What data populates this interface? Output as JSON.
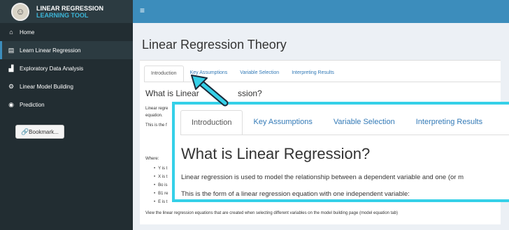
{
  "brand": {
    "title_line1": "LINEAR REGRESSION",
    "title_line2": "LEARNING TOOL",
    "logo_icon": "monk-avatar-icon"
  },
  "topbar": {
    "toggle_glyph": "≡",
    "color": "#3c8dbc"
  },
  "sidebar": {
    "items": [
      {
        "label": "Home",
        "icon": "home-icon",
        "glyph": "⌂"
      },
      {
        "label": "Learn Linear Regression",
        "icon": "book-icon",
        "glyph": "▤"
      },
      {
        "label": "Exploratory Data Analysis",
        "icon": "bar-chart-icon",
        "glyph": "▟"
      },
      {
        "label": "Linear Model Building",
        "icon": "gears-icon",
        "glyph": "⚙"
      },
      {
        "label": "Prediction",
        "icon": "dashboard-icon",
        "glyph": "◉"
      }
    ],
    "active_index": 1,
    "bookmark_label": "Bookmark...",
    "bookmark_glyph": "🔗"
  },
  "main": {
    "page_title": "Linear Regression Theory",
    "tabs": [
      "Introduction",
      "Key Assumptions",
      "Variable Selection",
      "Interpreting Results"
    ],
    "active_tab": "Introduction",
    "heading_partial_left": "What is Linear",
    "heading_partial_right": "ssion?",
    "intro_partial_1": "Linear regre",
    "intro_partial_2": "equation.",
    "intro_partial_3": "This is the f",
    "where_label": "Where:",
    "bullets_partial": [
      "Y is t",
      "X is t",
      "Bo is",
      "B1 re",
      "E is t"
    ],
    "footer": "View the linear regression equations that are created when selecting different variables on the model building page (model equation tab)"
  },
  "zoom": {
    "tabs": [
      "Introduction",
      "Key Assumptions",
      "Variable Selection",
      "Interpreting Results"
    ],
    "heading": "What is Linear Regression?",
    "line1": "Linear regression is used to model the relationship between a dependent variable and one (or m",
    "line2": "This is the form of a linear regression equation with one independent variable:",
    "border_color": "#35d0e8"
  }
}
